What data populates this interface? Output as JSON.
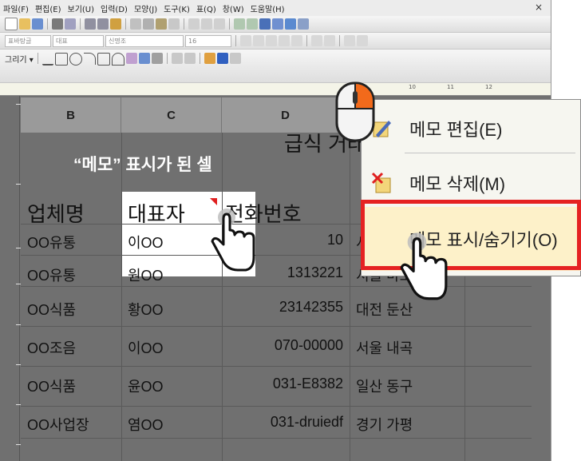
{
  "menu": {
    "items": [
      "파일(F)",
      "편집(E)",
      "보기(U)",
      "입력(D)",
      "모양(J)",
      "도구(K)",
      "표(Q)",
      "창(W)",
      "도움말(H)"
    ],
    "close": "×"
  },
  "format_bar": {
    "style": "표바탕글",
    "font_lang": "대표",
    "font": "신명조",
    "size": "16"
  },
  "ruler": {
    "marks": [
      "10",
      "11",
      "12"
    ]
  },
  "columns": [
    "B",
    "C",
    "D"
  ],
  "title_fragment": "급식 거래",
  "caption": "“메모” 표시가 된 셀",
  "table": {
    "headers": [
      "업체명",
      "대표자",
      "전화번호"
    ],
    "rows": [
      [
        "OO유통",
        "이OO",
        "10",
        "서"
      ],
      [
        "OO유통",
        "원OO",
        "1313221",
        "서울 마포구"
      ],
      [
        "OO식품",
        "황OO",
        "23142355",
        "대전 둔산"
      ],
      [
        "OO조음",
        "이OO",
        "070-00000",
        "서울 내곡"
      ],
      [
        "OO식품",
        "윤OO",
        "031-E8382",
        "일산 동구"
      ],
      [
        "OO사업장",
        "염OO",
        "031-druiedf",
        "경기 가평"
      ]
    ]
  },
  "context_menu": {
    "items": [
      "메모 편집(E)",
      "메모 삭제(M)",
      "메모 표시/숨기기(O)"
    ],
    "highlighted_index": 2
  },
  "colors": {
    "highlight_frame": "#e52222",
    "memo_marker": "#e02020",
    "mouse_button": "#f26a1b"
  }
}
